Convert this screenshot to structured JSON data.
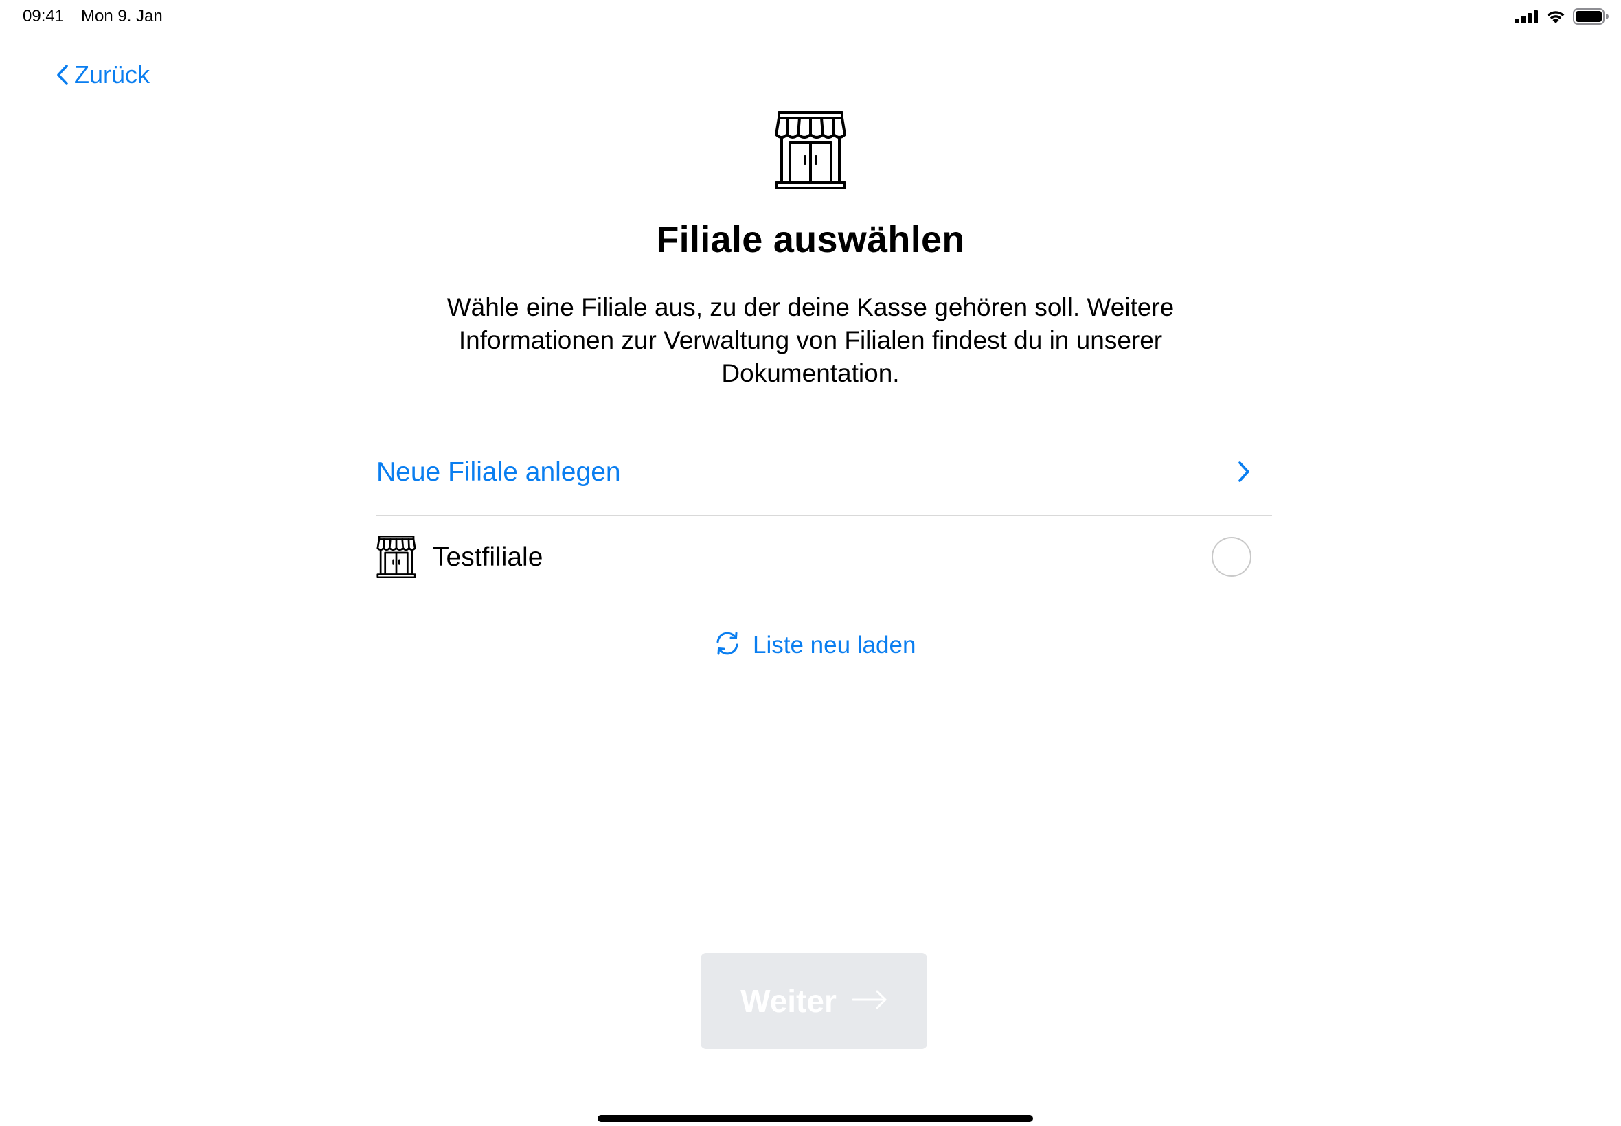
{
  "status_bar": {
    "time": "09:41",
    "date": "Mon 9. Jan",
    "icons": [
      "signal-icon",
      "wifi-icon",
      "battery-icon"
    ]
  },
  "nav": {
    "back_label": "Zurück",
    "back_icon": "chevron-left-icon"
  },
  "header": {
    "icon": "storefront-icon",
    "title": "Filiale auswählen",
    "description": "Wähle eine Filiale aus, zu der deine Kasse gehören soll. Weitere Informationen zur Verwaltung von Filialen findest du in unserer Dokumentation."
  },
  "list": {
    "new_store_label": "Neue Filiale anlegen",
    "new_store_icon": "chevron-right-icon",
    "stores": [
      {
        "name": "Testfiliale",
        "icon": "storefront-icon",
        "selected": false
      }
    ]
  },
  "reload": {
    "label": "Liste neu laden",
    "icon": "refresh-icon"
  },
  "footer": {
    "next_label": "Weiter",
    "next_icon": "arrow-right-icon",
    "next_enabled": false
  },
  "colors": {
    "accent": "#0a7ef0",
    "text": "#000000",
    "divider": "#d9d9d9",
    "disabled_button": "#e7e9ec"
  }
}
